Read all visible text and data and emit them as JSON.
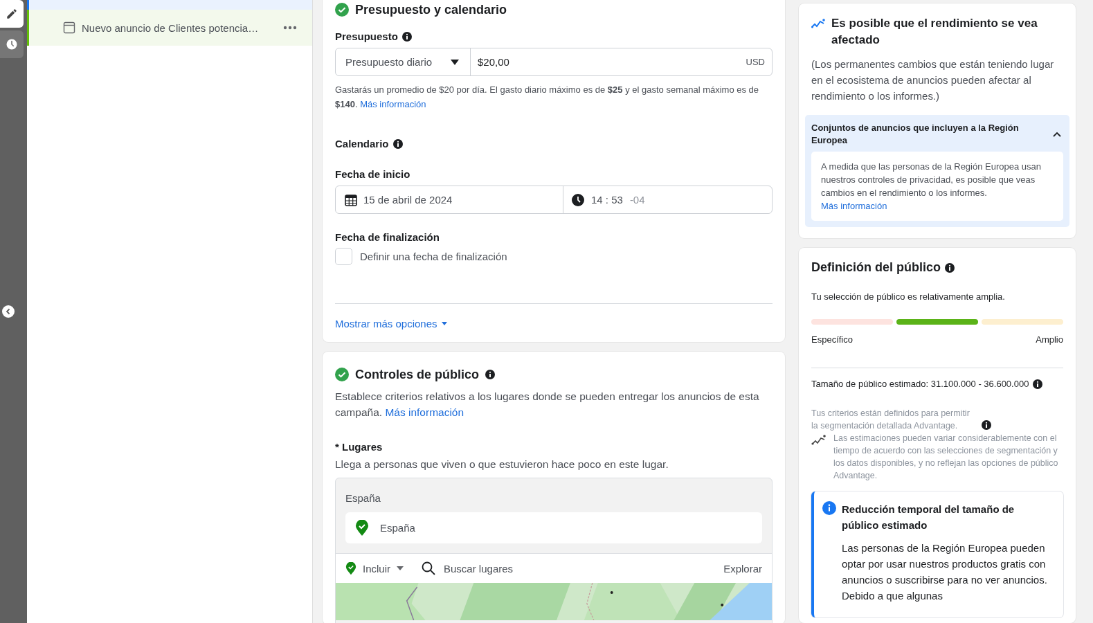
{
  "rail": {
    "items": [
      {
        "selected": true
      },
      {
        "selected": false
      }
    ]
  },
  "campaign_tree": {
    "items": [
      {
        "label": "Nuevo anuncio de Clientes potencia…",
        "selected": false
      }
    ]
  },
  "budget_section": {
    "title": "Presupuesto y calendario",
    "complete": true,
    "budget": {
      "label": "Presupuesto",
      "type_select": "Presupuesto diario",
      "amount": "$20,00",
      "currency": "USD",
      "note": "Gastarás un promedio de $20 por día. El gasto diario máximo es de **$25** y el gasto semanal máximo es de **$140**.",
      "note_link": "Más información"
    },
    "schedule": {
      "label": "Calendario",
      "start_label": "Fecha de inicio",
      "start_date": "15 de abril de 2024",
      "start_time": "14 : 53",
      "timezone": "-04",
      "end_label": "Fecha de finalización",
      "end_checkbox": {
        "label": "Definir una fecha de finalización",
        "checked": false
      }
    },
    "more_options": "Mostrar más opciones"
  },
  "audience_section": {
    "title": "Controles de público",
    "complete": true,
    "description": "Establece criterios relativos a los lugares donde se pueden entregar los anuncios de esta campaña.",
    "description_link": "Más información",
    "locations": {
      "label": "* Lugares",
      "hint": "Llega a personas que viven o que estuvieron hace poco en este lugar.",
      "group_label": "España",
      "items": [
        {
          "name": "España"
        }
      ],
      "include_select": "Incluir",
      "search": {
        "placeholder": "Buscar lugares"
      },
      "explore": "Explorar"
    }
  },
  "performance_card": {
    "title": "Es posible que el rendimiento se vea afectado",
    "body": "(Los permanentes cambios que están teniendo lugar en el ecosistema de anuncios pueden afectar al rendimiento o los informes.)",
    "accordion": {
      "title": "Conjuntos de anuncios que incluyen a la Región Europea",
      "expanded": true,
      "body": "A medida que las personas de la Región Europea usan nuestros controles de privacidad, es posible que veas cambios en el rendimiento o los informes.",
      "link": "Más información"
    }
  },
  "audience_definition": {
    "title": "Definición del público",
    "summary": "Tu selección de público es relativamente amplia.",
    "meter": {
      "segments": [
        {
          "selected": false
        },
        {
          "selected": true
        },
        {
          "selected": false
        }
      ],
      "min_label": "Específico",
      "max_label": "Amplio"
    },
    "estimated_size": "Tamaño de público estimado: 31.100.000 - 36.600.000",
    "criteria_note": "Tus criterios están definidos para permitir la segmentación detallada Advantage.",
    "estimate_note": "Las estimaciones pueden variar considerablemente con el tiempo de acuerdo con las selecciones de segmentación y los datos disponibles, y no reflejan las opciones de público Advantage.",
    "notice": {
      "title": "Reducción temporal del tamaño de público estimado",
      "body": "Las personas de la Región Europea pueden optar por usar nuestros productos gratis con anuncios o suscribirse para no ver anuncios. Debido a que algunas"
    }
  }
}
